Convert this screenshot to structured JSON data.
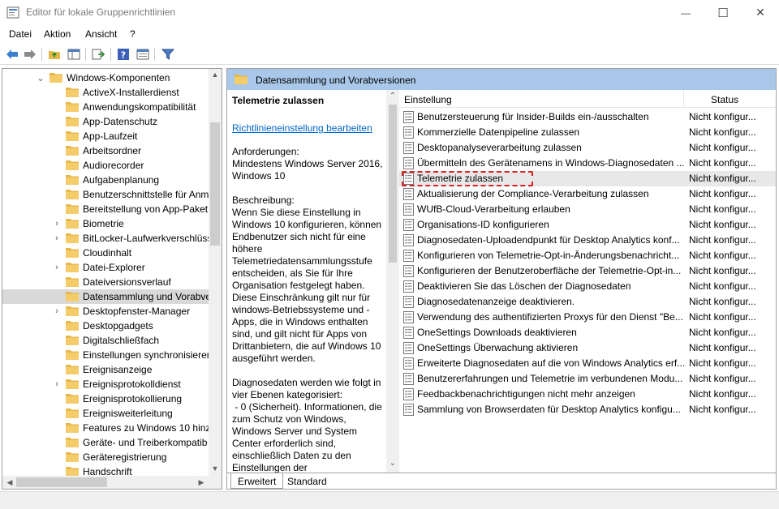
{
  "window": {
    "title": "Editor für lokale Gruppenrichtlinien",
    "min_glyph": "—",
    "max_glyph": "☐",
    "close_glyph": "✕"
  },
  "menu": [
    "Datei",
    "Aktion",
    "Ansicht",
    "?"
  ],
  "toolbar_icons": [
    "back-arrow-icon",
    "forward-arrow-icon",
    "up-folder-icon",
    "show-hide-tree-icon",
    "export-list-icon",
    "help-icon",
    "properties-icon",
    "filter-icon"
  ],
  "tree": {
    "items": [
      {
        "label": "Windows-Komponenten",
        "expander": "⌄",
        "level": 0
      },
      {
        "label": "ActiveX-Installerdienst",
        "expander": "",
        "level": 1
      },
      {
        "label": "Anwendungskompatibilität",
        "expander": "",
        "level": 1
      },
      {
        "label": "App-Datenschutz",
        "expander": "",
        "level": 1
      },
      {
        "label": "App-Laufzeit",
        "expander": "",
        "level": 1
      },
      {
        "label": "Arbeitsordner",
        "expander": "",
        "level": 1
      },
      {
        "label": "Audiorecorder",
        "expander": "",
        "level": 1
      },
      {
        "label": "Aufgabenplanung",
        "expander": "",
        "level": 1
      },
      {
        "label": "Benutzerschnittstelle für Anm",
        "expander": "",
        "level": 1
      },
      {
        "label": "Bereitstellung von App-Paket",
        "expander": "",
        "level": 1
      },
      {
        "label": "Biometrie",
        "expander": "›",
        "level": 1
      },
      {
        "label": "BitLocker-Laufwerkverschlüss",
        "expander": "›",
        "level": 1
      },
      {
        "label": "Cloudinhalt",
        "expander": "",
        "level": 1
      },
      {
        "label": "Datei-Explorer",
        "expander": "›",
        "level": 1
      },
      {
        "label": "Dateiversionsverlauf",
        "expander": "",
        "level": 1
      },
      {
        "label": "Datensammlung und Vorabve",
        "expander": "",
        "level": 1,
        "selected": true
      },
      {
        "label": "Desktopfenster-Manager",
        "expander": "›",
        "level": 1
      },
      {
        "label": "Desktopgadgets",
        "expander": "",
        "level": 1
      },
      {
        "label": "Digitalschließfach",
        "expander": "",
        "level": 1
      },
      {
        "label": "Einstellungen synchronisierer",
        "expander": "",
        "level": 1
      },
      {
        "label": "Ereignisanzeige",
        "expander": "",
        "level": 1
      },
      {
        "label": "Ereignisprotokolldienst",
        "expander": "›",
        "level": 1
      },
      {
        "label": "Ereignisprotokollierung",
        "expander": "",
        "level": 1
      },
      {
        "label": "Ereignisweiterleitung",
        "expander": "",
        "level": 1
      },
      {
        "label": "Features zu Windows 10 hinzu",
        "expander": "",
        "level": 1
      },
      {
        "label": "Geräte- und Treiberkompatib",
        "expander": "",
        "level": 1
      },
      {
        "label": "Geräteregistrierung",
        "expander": "",
        "level": 1
      },
      {
        "label": "Handschrift",
        "expander": "",
        "level": 1
      }
    ]
  },
  "right": {
    "header": "Datensammlung und Vorabversionen",
    "description": {
      "title": "Telemetrie zulassen",
      "link": "Richtlinieneinstellung bearbeiten",
      "body": "Anforderungen:\nMindestens Windows Server 2016, Windows 10\n\nBeschreibung:\nWenn Sie diese Einstellung in Windows 10 konfigurieren, können Endbenutzer sich nicht für eine höhere Telemetriedatensammlungsstufe entscheiden, als Sie für Ihre Organisation festgelegt haben. Diese Einschränkung gilt nur für windows-Betriebssysteme und -Apps, die in Windows enthalten sind, und gilt nicht für Apps von Drittanbietern, die auf Windows 10 ausgeführt werden.\n\nDiagnosedaten werden wie folgt in vier Ebenen kategorisiert:\n - 0 (Sicherheit). Informationen, die zum Schutz von Windows, Windows Server und System Center erforderlich sind, einschließlich Daten zu den Einstellungen der"
    },
    "columns": {
      "setting": "Einstellung",
      "status": "Status"
    },
    "rows": [
      {
        "name": "Benutzersteuerung für Insider-Builds ein-/ausschalten",
        "status": "Nicht konfigur..."
      },
      {
        "name": "Kommerzielle Datenpipeline zulassen",
        "status": "Nicht konfigur..."
      },
      {
        "name": "Desktopanalyseverarbeitung zulassen",
        "status": "Nicht konfigur..."
      },
      {
        "name": "Übermitteln des Gerätenamens in Windows-Diagnosedaten ...",
        "status": "Nicht konfigur..."
      },
      {
        "name": "Telemetrie zulassen",
        "status": "Nicht konfigur...",
        "selected": true
      },
      {
        "name": "Aktualisierung der Compliance-Verarbeitung zulassen",
        "status": "Nicht konfigur..."
      },
      {
        "name": "WUfB-Cloud-Verarbeitung erlauben",
        "status": "Nicht konfigur..."
      },
      {
        "name": "Organisations-ID konfigurieren",
        "status": "Nicht konfigur..."
      },
      {
        "name": "Diagnosedaten-Uploadendpunkt für Desktop Analytics konf...",
        "status": "Nicht konfigur..."
      },
      {
        "name": "Konfigurieren von Telemetrie-Opt-in-Änderungsbenachricht...",
        "status": "Nicht konfigur..."
      },
      {
        "name": "Konfigurieren der Benutzeroberfläche der Telemetrie-Opt-in...",
        "status": "Nicht konfigur..."
      },
      {
        "name": "Deaktivieren Sie das Löschen der Diagnosedaten",
        "status": "Nicht konfigur..."
      },
      {
        "name": "Diagnosedatenanzeige deaktivieren.",
        "status": "Nicht konfigur..."
      },
      {
        "name": "Verwendung des authentifizierten Proxys für den Dienst \"Be...",
        "status": "Nicht konfigur..."
      },
      {
        "name": "OneSettings Downloads deaktivieren",
        "status": "Nicht konfigur..."
      },
      {
        "name": "OneSettings Überwachung aktivieren",
        "status": "Nicht konfigur..."
      },
      {
        "name": "Erweiterte Diagnosedaten auf die von Windows Analytics erf...",
        "status": "Nicht konfigur..."
      },
      {
        "name": "Benutzererfahrungen und Telemetrie im verbundenen Modu...",
        "status": "Nicht konfigur..."
      },
      {
        "name": "Feedbackbenachrichtigungen nicht mehr anzeigen",
        "status": "Nicht konfigur..."
      },
      {
        "name": "Sammlung von Browserdaten für Desktop Analytics konfigu...",
        "status": "Nicht konfigur..."
      }
    ],
    "tabs": [
      "Erweitert",
      "Standard"
    ],
    "active_tab": "Erweitert"
  },
  "colors": {
    "header_blue": "#a9c7e8",
    "link": "#0066cc",
    "focus_red": "#e02020",
    "folder": "#e8b84a"
  }
}
